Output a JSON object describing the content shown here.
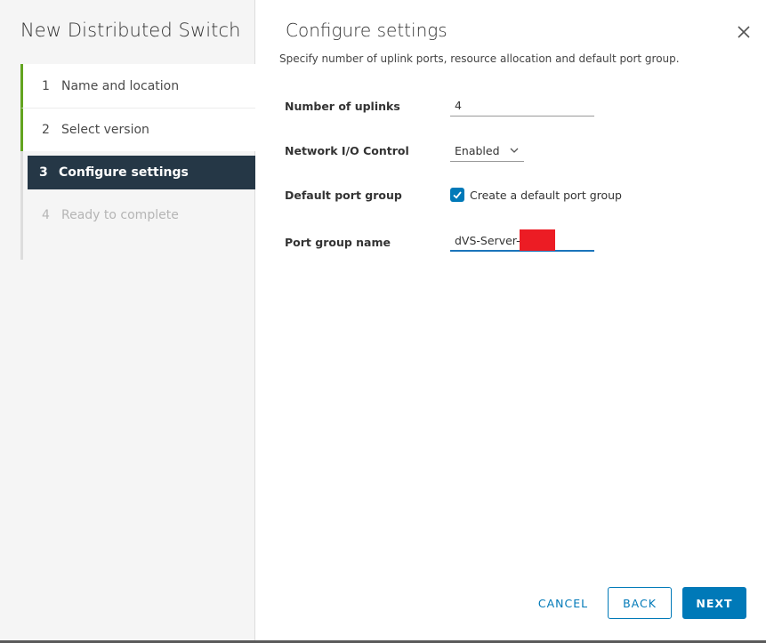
{
  "wizard": {
    "title": "New Distributed Switch",
    "steps": [
      {
        "num": "1",
        "label": "Name and location",
        "state": "done"
      },
      {
        "num": "2",
        "label": "Select version",
        "state": "done"
      },
      {
        "num": "3",
        "label": "Configure settings",
        "state": "active"
      },
      {
        "num": "4",
        "label": "Ready to complete",
        "state": "disabled"
      }
    ]
  },
  "page": {
    "title": "Configure settings",
    "subtitle": "Specify number of uplink ports, resource allocation and default port group."
  },
  "form": {
    "uplinks": {
      "label": "Number of uplinks",
      "value": "4"
    },
    "nioc": {
      "label": "Network I/O Control",
      "selected": "Enabled"
    },
    "default_pg": {
      "label": "Default port group",
      "checkbox_label": "Create a default port group",
      "checked": true
    },
    "pg_name": {
      "label": "Port group name",
      "value": "dVS-Server-"
    }
  },
  "footer": {
    "cancel": "CANCEL",
    "back": "BACK",
    "next": "NEXT"
  },
  "colors": {
    "accent": "#0079b8",
    "active_step_bg": "#253746",
    "done_step_bar": "#62a420",
    "redaction": "#ec1c24"
  },
  "icons": {
    "close": "close-icon",
    "select_chevron": "chevron-down-icon",
    "checkbox_check": "checkmark-icon"
  }
}
